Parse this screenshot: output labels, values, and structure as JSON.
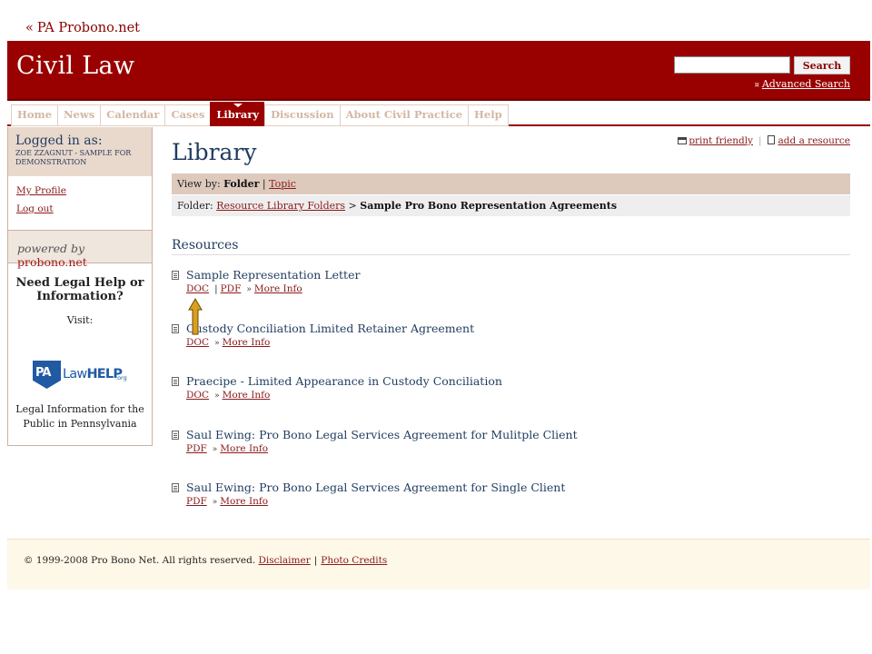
{
  "back_link": {
    "arrow": "«",
    "label": "PA Probono.net"
  },
  "header": {
    "title": "Civil Law",
    "search": {
      "value": "",
      "placeholder": "",
      "button": "Search"
    },
    "advanced_mark": "¤",
    "advanced_search": "Advanced Search"
  },
  "nav": {
    "items": [
      {
        "label": "Home"
      },
      {
        "label": "News"
      },
      {
        "label": "Calendar"
      },
      {
        "label": "Cases"
      },
      {
        "label": "Library"
      },
      {
        "label": "Discussion"
      },
      {
        "label": "About Civil Practice"
      },
      {
        "label": "Help"
      }
    ],
    "active": "Library"
  },
  "sidebar": {
    "logged_in_label": "Logged in as:",
    "user": "ZOE ZZAGNUT - SAMPLE FOR DEMONSTRATION",
    "links": [
      "My Profile",
      "Log out"
    ],
    "powered_by": "powered by",
    "powered_brand": "probono.net",
    "need_help": "Need Legal Help or Information?",
    "visit": "Visit:",
    "lawhelp_pa": "PA",
    "lawhelp_law": "Law",
    "lawhelp_help": "HELP",
    "lawhelp_org": ".org",
    "legal_info": "Legal Information for the Public in Pennsylvania"
  },
  "main": {
    "title": "Library",
    "print_friendly": "print friendly",
    "add_resource": "add a resource",
    "view_by": {
      "label": "View by:",
      "folder": "Folder",
      "separator": "|",
      "topic": "Topic"
    },
    "folder": {
      "label": "Folder:",
      "parent": "Resource Library Folders",
      "separator": ">",
      "current": "Sample Pro Bono Representation Agreements"
    },
    "resources_heading": "Resources",
    "resources": [
      {
        "title": "Sample Representation Letter",
        "formats": [
          "DOC",
          "PDF"
        ],
        "more": "More Info"
      },
      {
        "title": "Custody Conciliation Limited Retainer Agreement",
        "formats": [
          "DOC"
        ],
        "more": "More Info"
      },
      {
        "title": "Praecipe - Limited Appearance in Custody Conciliation",
        "formats": [
          "DOC"
        ],
        "more": "More Info"
      },
      {
        "title": "Saul Ewing: Pro Bono Legal Services Agreement for Mulitple Client",
        "formats": [
          "PDF"
        ],
        "more": "More Info"
      },
      {
        "title": "Saul Ewing: Pro Bono Legal Services Agreement for Single Client",
        "formats": [
          "PDF"
        ],
        "more": "More Info"
      }
    ],
    "more_marker": "»"
  },
  "footer": {
    "copyright": "© 1999-2008 Pro Bono Net. All rights reserved.",
    "disclaimer": "Disclaimer",
    "separator": "|",
    "photo_credits": "Photo Credits"
  },
  "colors": {
    "brand": "#990000",
    "arrow": "#d8a020"
  },
  "icons": [
    "print-icon",
    "document-icon",
    "resource-doc-icon",
    "annotation-arrow-icon",
    "lawhelp-logo"
  ]
}
